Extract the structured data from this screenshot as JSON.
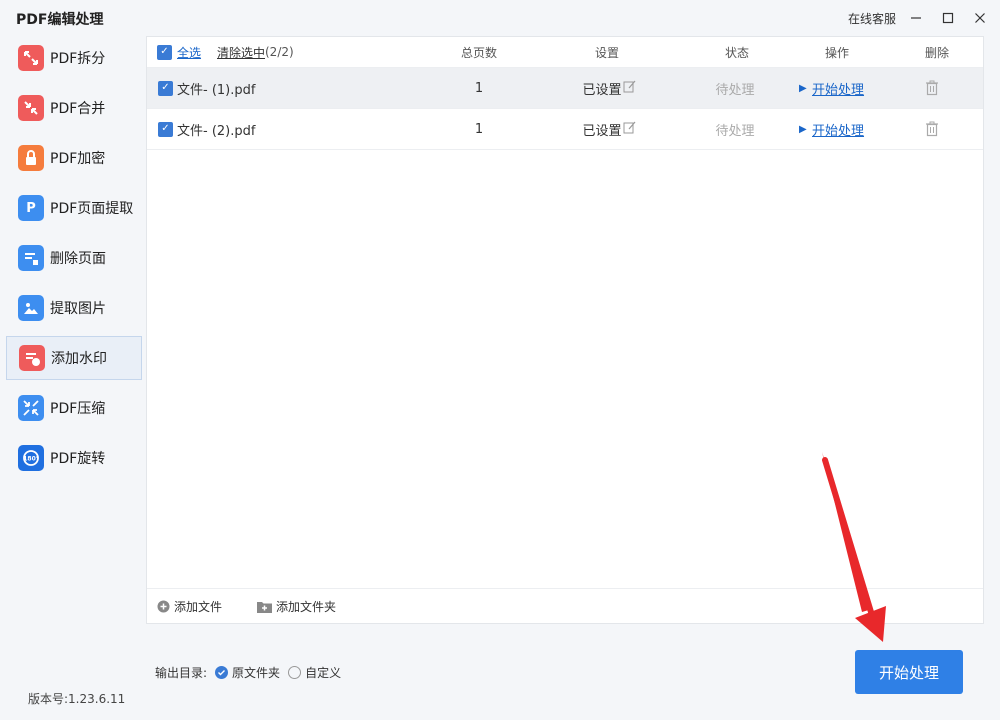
{
  "app": {
    "title": "PDF编辑处理",
    "customer_service": "在线客服",
    "version": "版本号:1.23.6.11"
  },
  "sidebar": {
    "items": [
      {
        "label": "PDF拆分",
        "icon": "split-icon",
        "color": "#ef5b5b"
      },
      {
        "label": "PDF合并",
        "icon": "merge-icon",
        "color": "#ef5b5b"
      },
      {
        "label": "PDF加密",
        "icon": "lock-icon",
        "color": "#f57c3d"
      },
      {
        "label": "PDF页面提取",
        "icon": "page-extract-icon",
        "color": "#3d8ef0"
      },
      {
        "label": "删除页面",
        "icon": "delete-page-icon",
        "color": "#3d8ef0"
      },
      {
        "label": "提取图片",
        "icon": "image-extract-icon",
        "color": "#3d8ef0"
      },
      {
        "label": "添加水印",
        "icon": "watermark-icon",
        "color": "#ef5b5b",
        "active": true
      },
      {
        "label": "PDF压缩",
        "icon": "compress-icon",
        "color": "#3d8ef0"
      },
      {
        "label": "PDF旋转",
        "icon": "rotate-icon",
        "color": "#1f6fe0"
      }
    ]
  },
  "table": {
    "select_all": "全选",
    "clear_selected": "清除选中",
    "selected_count": "(2/2)",
    "columns": {
      "pages": "总页数",
      "settings": "设置",
      "status": "状态",
      "action": "操作",
      "delete": "删除"
    },
    "rows": [
      {
        "name": "文件- (1).pdf",
        "pages": "1",
        "settings": "已设置",
        "status": "待处理",
        "action": "开始处理"
      },
      {
        "name": "文件- (2).pdf",
        "pages": "1",
        "settings": "已设置",
        "status": "待处理",
        "action": "开始处理"
      }
    ],
    "add_file": "添加文件",
    "add_folder": "添加文件夹"
  },
  "output": {
    "label": "输出目录:",
    "options": [
      "原文件夹",
      "自定义"
    ],
    "selected": "原文件夹"
  },
  "start_button": "开始处理",
  "accent": "#2f80e6",
  "arrow_color": "#e8282b"
}
